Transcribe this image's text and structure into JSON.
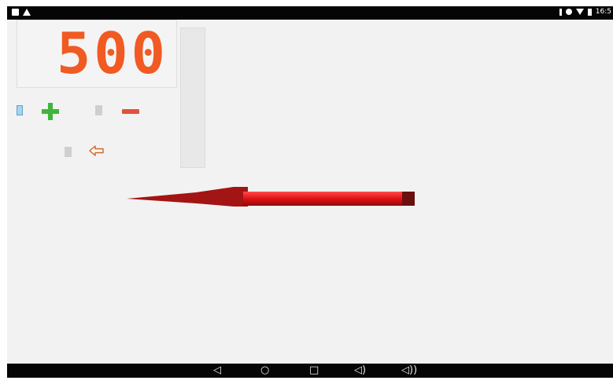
{
  "display": {
    "value": "500",
    "color": "#f15a22"
  },
  "status_bar": {
    "time": "16:5"
  },
  "controls": {
    "plus_icon": "plus-icon",
    "minus_icon": "minus-icon",
    "back_icon": "back-arrow-icon"
  },
  "nav": {
    "back": "◁",
    "home": "○",
    "recents": "□",
    "vol_down": "◁)",
    "vol_up": "◁))"
  },
  "colors": {
    "plus": "#3eb53e",
    "minus": "#e0523a",
    "arrow": "#cc1a1a"
  }
}
